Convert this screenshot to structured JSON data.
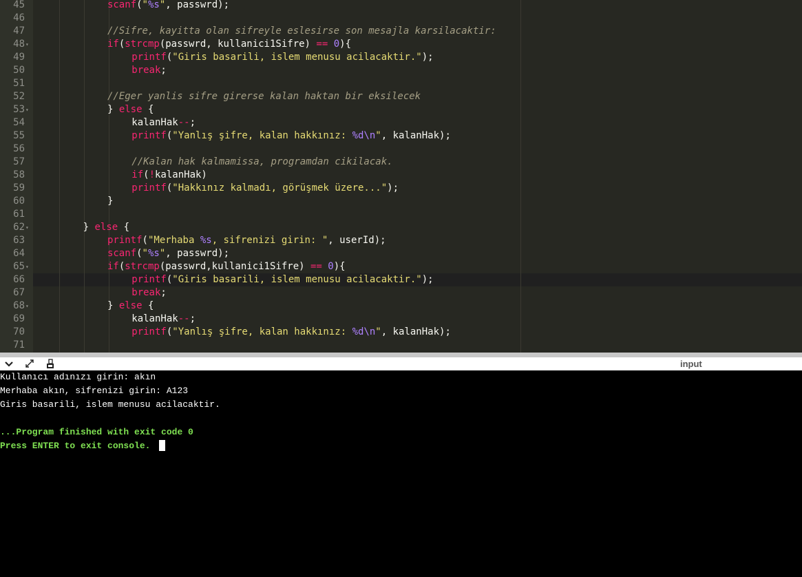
{
  "editor": {
    "lines": [
      {
        "n": "45",
        "fold": false,
        "indent": 3,
        "tokens": [
          [
            "fn",
            "scanf"
          ],
          [
            "p",
            "("
          ],
          [
            "st",
            "\""
          ],
          [
            "fmt",
            "%s"
          ],
          [
            "st",
            "\""
          ],
          [
            "p",
            ", passwrd);"
          ]
        ]
      },
      {
        "n": "46",
        "fold": false,
        "indent": 0,
        "tokens": []
      },
      {
        "n": "47",
        "fold": false,
        "indent": 3,
        "tokens": [
          [
            "cm",
            "//Sifre, kayitta olan sifreyle eslesirse son mesajla karsilacaktir:"
          ]
        ]
      },
      {
        "n": "48",
        "fold": true,
        "indent": 3,
        "tokens": [
          [
            "kw",
            "if"
          ],
          [
            "p",
            "("
          ],
          [
            "fn",
            "strcmp"
          ],
          [
            "p",
            "(passwrd, kullanici1Sifre) "
          ],
          [
            "op",
            "=="
          ],
          [
            "p",
            " "
          ],
          [
            "nm",
            "0"
          ],
          [
            "p",
            "){"
          ]
        ]
      },
      {
        "n": "49",
        "fold": false,
        "indent": 4,
        "tokens": [
          [
            "fn",
            "printf"
          ],
          [
            "p",
            "("
          ],
          [
            "st",
            "\"Giris basarili, islem menusu acilacaktir.\""
          ],
          [
            "p",
            ");"
          ]
        ]
      },
      {
        "n": "50",
        "fold": false,
        "indent": 4,
        "tokens": [
          [
            "kw",
            "break"
          ],
          [
            "p",
            ";"
          ]
        ]
      },
      {
        "n": "51",
        "fold": false,
        "indent": 0,
        "tokens": []
      },
      {
        "n": "52",
        "fold": false,
        "indent": 3,
        "tokens": [
          [
            "cm",
            "//Eger yanlis sifre girerse kalan haktan bir eksilecek"
          ]
        ]
      },
      {
        "n": "53",
        "fold": true,
        "indent": 3,
        "tokens": [
          [
            "p",
            "} "
          ],
          [
            "kw",
            "else"
          ],
          [
            "p",
            " {"
          ]
        ]
      },
      {
        "n": "54",
        "fold": false,
        "indent": 4,
        "tokens": [
          [
            "p",
            "kalanHak"
          ],
          [
            "op",
            "--"
          ],
          [
            "p",
            ";"
          ]
        ]
      },
      {
        "n": "55",
        "fold": false,
        "indent": 4,
        "tokens": [
          [
            "fn",
            "printf"
          ],
          [
            "p",
            "("
          ],
          [
            "st",
            "\"Yanlış şifre, kalan hakkınız: "
          ],
          [
            "fmt",
            "%d\\n"
          ],
          [
            "st",
            "\""
          ],
          [
            "p",
            ", kalanHak);"
          ]
        ]
      },
      {
        "n": "56",
        "fold": false,
        "indent": 0,
        "tokens": []
      },
      {
        "n": "57",
        "fold": false,
        "indent": 4,
        "tokens": [
          [
            "cm",
            "//Kalan hak kalmamissa, programdan cikilacak."
          ]
        ]
      },
      {
        "n": "58",
        "fold": false,
        "indent": 4,
        "tokens": [
          [
            "kw",
            "if"
          ],
          [
            "p",
            "("
          ],
          [
            "op",
            "!"
          ],
          [
            "p",
            "kalanHak)"
          ]
        ]
      },
      {
        "n": "59",
        "fold": false,
        "indent": 4,
        "tokens": [
          [
            "fn",
            "printf"
          ],
          [
            "p",
            "("
          ],
          [
            "st",
            "\"Hakkınız kalmadı, görüşmek üzere...\""
          ],
          [
            "p",
            ");"
          ]
        ]
      },
      {
        "n": "60",
        "fold": false,
        "indent": 3,
        "tokens": [
          [
            "p",
            "}"
          ]
        ]
      },
      {
        "n": "61",
        "fold": false,
        "indent": 0,
        "tokens": []
      },
      {
        "n": "62",
        "fold": true,
        "indent": 2,
        "tokens": [
          [
            "p",
            "} "
          ],
          [
            "kw",
            "else"
          ],
          [
            "p",
            " {"
          ]
        ]
      },
      {
        "n": "63",
        "fold": false,
        "indent": 3,
        "tokens": [
          [
            "fn",
            "printf"
          ],
          [
            "p",
            "("
          ],
          [
            "st",
            "\"Merhaba "
          ],
          [
            "fmt",
            "%s"
          ],
          [
            "st",
            ", sifrenizi girin: \""
          ],
          [
            "p",
            ", userId);"
          ]
        ]
      },
      {
        "n": "64",
        "fold": false,
        "indent": 3,
        "tokens": [
          [
            "fn",
            "scanf"
          ],
          [
            "p",
            "("
          ],
          [
            "st",
            "\""
          ],
          [
            "fmt",
            "%s"
          ],
          [
            "st",
            "\""
          ],
          [
            "p",
            ", passwrd);"
          ]
        ]
      },
      {
        "n": "65",
        "fold": true,
        "indent": 3,
        "tokens": [
          [
            "kw",
            "if"
          ],
          [
            "p",
            "("
          ],
          [
            "fn",
            "strcmp"
          ],
          [
            "p",
            "(passwrd,kullanici1Sifre) "
          ],
          [
            "op",
            "=="
          ],
          [
            "p",
            " "
          ],
          [
            "nm",
            "0"
          ],
          [
            "p",
            "){"
          ]
        ]
      },
      {
        "n": "66",
        "fold": false,
        "indent": 4,
        "active": true,
        "tokens": [
          [
            "fn",
            "printf"
          ],
          [
            "p",
            "("
          ],
          [
            "st",
            "\"Giris basarili, islem menusu acilacaktir.\""
          ],
          [
            "p",
            ");"
          ]
        ]
      },
      {
        "n": "67",
        "fold": false,
        "indent": 4,
        "tokens": [
          [
            "kw",
            "break"
          ],
          [
            "p",
            ";"
          ]
        ]
      },
      {
        "n": "68",
        "fold": true,
        "indent": 3,
        "tokens": [
          [
            "p",
            "} "
          ],
          [
            "kw",
            "else"
          ],
          [
            "p",
            " {"
          ]
        ]
      },
      {
        "n": "69",
        "fold": false,
        "indent": 4,
        "tokens": [
          [
            "p",
            "kalanHak"
          ],
          [
            "op",
            "--"
          ],
          [
            "p",
            ";"
          ]
        ]
      },
      {
        "n": "70",
        "fold": false,
        "indent": 4,
        "tokens": [
          [
            "fn",
            "printf"
          ],
          [
            "p",
            "("
          ],
          [
            "st",
            "\"Yanlış şifre, kalan hakkınız: "
          ],
          [
            "fmt",
            "%d\\n"
          ],
          [
            "st",
            "\""
          ],
          [
            "p",
            ", kalanHak);"
          ]
        ]
      },
      {
        "n": "71",
        "fold": false,
        "indent": 0,
        "tokens": []
      }
    ]
  },
  "toolbar": {
    "collapse_icon": "chevron-down-icon",
    "expand_icon": "expand-arrows-icon",
    "copy_icon": "copy-icon",
    "input_label": "input"
  },
  "console": {
    "lines": [
      {
        "text": "Kullanıcı adınızı girin: akın",
        "style": "normal"
      },
      {
        "text": "Merhaba akın, sifrenizi girin: A123",
        "style": "normal"
      },
      {
        "text": "Giris basarili, islem menusu acilacaktir.",
        "style": "normal"
      },
      {
        "text": "",
        "style": "normal"
      },
      {
        "text": "...Program finished with exit code 0",
        "style": "green"
      },
      {
        "text": "Press ENTER to exit console.",
        "style": "green"
      }
    ]
  },
  "colors": {
    "editor_bg": "#272822",
    "keyword": "#f92672",
    "string": "#e6db74",
    "number": "#ae81ff",
    "comment": "#a59f85",
    "console_bg": "#000000",
    "console_green": "#7fe052"
  }
}
